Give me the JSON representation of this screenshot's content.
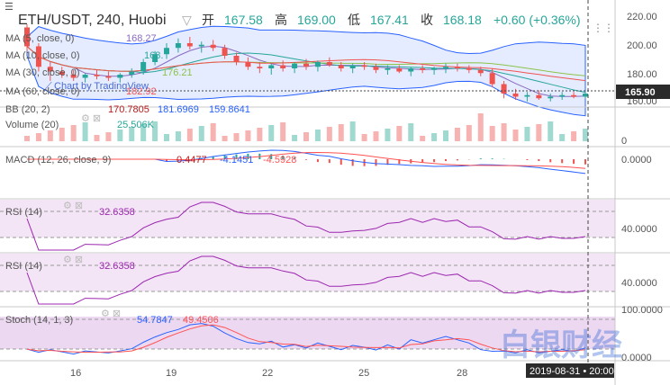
{
  "header": {
    "symbol_line": "ETH/USDT, 240, Huobi",
    "open_label": "开",
    "open": "167.58",
    "high_label": "高",
    "high": "169.00",
    "low_label": "低",
    "low": "167.41",
    "close_label": "收",
    "close": "168.18",
    "change": "+0.60 (+0.36%)"
  },
  "indicators": {
    "ma5": {
      "label": "MA (5, close, 0)",
      "value": "168.27"
    },
    "ma10": {
      "label": "MA (10, close, 0)",
      "value": "168."
    },
    "ma30": {
      "label": "MA (30, close, 0)",
      "value": "176.21"
    },
    "ma60": {
      "label": "MA (60, close, 0)",
      "value": "182.92"
    },
    "bb": {
      "label": "BB (20, 2)",
      "v1": "170.7805",
      "v2": "181.6969",
      "v3": "159.8641"
    }
  },
  "watermark": "Chart by TradingView",
  "price_axis": [
    "220.00",
    "200.00",
    "180.00",
    "160.00"
  ],
  "price_badge": "165.90",
  "volume": {
    "label": "Volume (20)",
    "value": "25.506K",
    "axis": [
      "0"
    ]
  },
  "macd": {
    "label": "MACD (12, 26, close, 9)",
    "v1": "0.4477",
    "v2": "-4.1451",
    "v3": "-4.5928",
    "axis": [
      "0.0000"
    ]
  },
  "rsi1": {
    "label": "RSI (14)",
    "value": "32.6358",
    "axis": [
      "40.0000"
    ]
  },
  "rsi2": {
    "label": "RSI (14)",
    "value": "32.6358",
    "axis": [
      "40.0000"
    ]
  },
  "stoch": {
    "label": "Stoch (14, 1, 3)",
    "v1": "54.7847",
    "v2": "49.4506",
    "axis": [
      "100.0000",
      "0.0000"
    ]
  },
  "x_axis": [
    "16",
    "19",
    "22",
    "25",
    "28"
  ],
  "crosshair_date": "2019-08-31 • 20:00",
  "corner_watermark": "白银财经",
  "colors": {
    "up": "#26a69a",
    "down": "#ef5350",
    "bb": "#2962ff",
    "rsi": "#9c27b0",
    "macd": "#2962ff",
    "signal": "#ff5252"
  },
  "chart_data": {
    "type": "candlestick",
    "ohlc": [
      [
        210,
        212,
        195,
        198
      ],
      [
        198,
        200,
        182,
        185
      ],
      [
        185,
        188,
        176,
        182
      ],
      [
        182,
        185,
        178,
        180
      ],
      [
        180,
        183,
        176,
        178
      ],
      [
        178,
        181,
        175,
        180
      ],
      [
        180,
        183,
        177,
        179
      ],
      [
        179,
        182,
        176,
        178
      ],
      [
        178,
        181,
        175,
        180
      ],
      [
        180,
        184,
        178,
        182
      ],
      [
        182,
        190,
        180,
        188
      ],
      [
        188,
        195,
        186,
        193
      ],
      [
        193,
        200,
        190,
        197
      ],
      [
        197,
        203,
        194,
        200
      ],
      [
        200,
        204,
        196,
        198
      ],
      [
        198,
        201,
        194,
        199
      ],
      [
        199,
        202,
        195,
        197
      ],
      [
        197,
        199,
        190,
        192
      ],
      [
        192,
        194,
        186,
        188
      ],
      [
        188,
        191,
        183,
        185
      ],
      [
        185,
        188,
        181,
        184
      ],
      [
        184,
        187,
        180,
        186
      ],
      [
        186,
        189,
        182,
        184
      ],
      [
        184,
        188,
        181,
        187
      ],
      [
        187,
        190,
        183,
        185
      ],
      [
        185,
        189,
        182,
        188
      ],
      [
        188,
        191,
        185,
        186
      ],
      [
        186,
        188,
        182,
        184
      ],
      [
        184,
        187,
        181,
        186
      ],
      [
        186,
        188,
        183,
        185
      ],
      [
        185,
        187,
        181,
        183
      ],
      [
        183,
        186,
        180,
        184
      ],
      [
        184,
        186,
        181,
        182
      ],
      [
        182,
        185,
        179,
        184
      ],
      [
        184,
        186,
        181,
        183
      ],
      [
        183,
        185,
        180,
        184
      ],
      [
        184,
        187,
        181,
        185
      ],
      [
        185,
        187,
        182,
        184
      ],
      [
        184,
        186,
        181,
        183
      ],
      [
        183,
        185,
        179,
        181
      ],
      [
        181,
        184,
        172,
        174
      ],
      [
        174,
        176,
        165,
        168
      ],
      [
        168,
        171,
        164,
        166
      ],
      [
        166,
        169,
        163,
        167
      ],
      [
        167,
        170,
        164,
        165
      ],
      [
        165,
        168,
        163,
        166
      ],
      [
        166,
        169,
        164,
        167
      ],
      [
        167,
        169,
        165,
        166
      ],
      [
        166,
        169,
        165,
        168
      ]
    ],
    "x_labels": [
      "16",
      "19",
      "22",
      "25",
      "28"
    ],
    "y_range": [
      160,
      220
    ]
  }
}
